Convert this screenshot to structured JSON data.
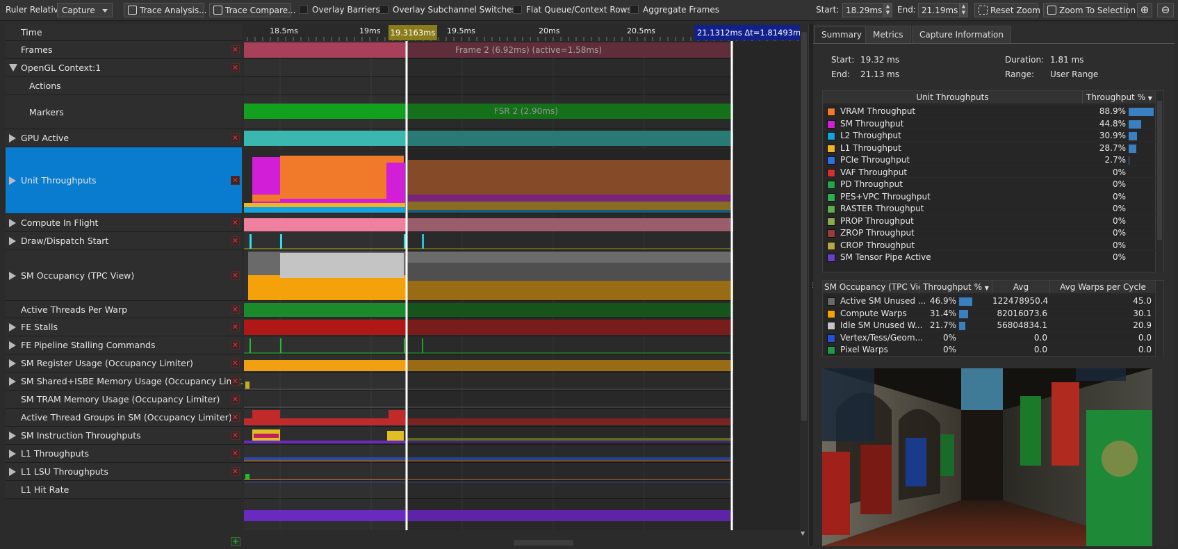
{
  "toolbar": {
    "ruler_label": "Ruler Relative:",
    "ruler_value": "Capture",
    "trace_analysis": "Trace Analysis...",
    "trace_compare": "Trace Compare...",
    "overlay_barriers": "Overlay Barriers",
    "overlay_subchannel": "Overlay Subchannel Switches",
    "flat_queue": "Flat Queue/Context Rows",
    "aggregate_frames": "Aggregate Frames",
    "start_label": "Start:",
    "start_value": "18.29ms",
    "end_label": "End:",
    "end_value": "21.19ms",
    "reset_zoom": "Reset Zoom",
    "zoom_to_selection": "Zoom To Selection"
  },
  "rows": [
    {
      "label": "Time",
      "expander": "none",
      "remove": false
    },
    {
      "label": "Frames",
      "expander": "none",
      "remove": true
    },
    {
      "label": "OpenGL Context:1",
      "expander": "expanded",
      "remove": true
    },
    {
      "label": "Actions",
      "expander": "none",
      "remove": false,
      "indent": true
    },
    {
      "label": "Markers",
      "expander": "none",
      "remove": false,
      "indent": true
    },
    {
      "label": "GPU Active",
      "expander": "collapsed",
      "remove": true
    },
    {
      "label": "Unit Throughputs",
      "expander": "collapsed",
      "remove": true,
      "selected": true
    },
    {
      "label": "Compute In Flight",
      "expander": "collapsed",
      "remove": true
    },
    {
      "label": "Draw/Dispatch Start",
      "expander": "collapsed",
      "remove": true
    },
    {
      "label": "SM Occupancy (TPC View)",
      "expander": "collapsed",
      "remove": true
    },
    {
      "label": "Active Threads Per Warp",
      "expander": "none",
      "remove": true
    },
    {
      "label": "FE Stalls",
      "expander": "collapsed",
      "remove": true
    },
    {
      "label": "FE Pipeline Stalling Commands",
      "expander": "collapsed",
      "remove": true
    },
    {
      "label": "SM Register Usage (Occupancy Limiter)",
      "expander": "collapsed",
      "remove": true
    },
    {
      "label": "SM Shared+ISBE Memory Usage (Occupancy Limit...",
      "expander": "collapsed",
      "remove": true
    },
    {
      "label": "SM TRAM Memory Usage (Occupancy Limiter)",
      "expander": "none",
      "remove": true
    },
    {
      "label": "Active Thread Groups in SM (Occupancy Limiter)",
      "expander": "none",
      "remove": true
    },
    {
      "label": "SM Instruction Throughputs",
      "expander": "collapsed",
      "remove": true
    },
    {
      "label": "L1 Throughputs",
      "expander": "collapsed",
      "remove": true
    },
    {
      "label": "L1 LSU Throughputs",
      "expander": "collapsed",
      "remove": true
    },
    {
      "label": "L1 Hit Rate",
      "expander": "none",
      "remove": false
    }
  ],
  "timeline": {
    "ticks": [
      "18.5ms",
      "19ms",
      "19.5ms",
      "20ms",
      "20.5ms"
    ],
    "cursor_label": "19.3163ms",
    "range_label": "21.1312ms Δt=1.81493ms",
    "frame_label": "Frame 2 (6.92ms) (active=1.58ms)",
    "marker_label": "FSR 2 (2.90ms)"
  },
  "tabs": [
    "Summary",
    "Metrics",
    "Capture Information"
  ],
  "summary": {
    "start_label": "Start:",
    "start_value": "19.32 ms",
    "end_label": "End:",
    "end_value": "21.13 ms",
    "duration_label": "Duration:",
    "duration_value": "1.81 ms",
    "range_label": "Range:",
    "range_value": "User Range"
  },
  "unit_table": {
    "headers": [
      "Unit Throughputs",
      "Throughput %"
    ],
    "rows": [
      {
        "name": "VRAM Throughput",
        "value": "88.9%",
        "pct": 88.9,
        "color": "#f07a2a"
      },
      {
        "name": "SM Throughput",
        "value": "44.8%",
        "pct": 44.8,
        "color": "#d21ed6"
      },
      {
        "name": "L2 Throughput",
        "value": "30.9%",
        "pct": 30.9,
        "color": "#12a4e0"
      },
      {
        "name": "L1 Throughput",
        "value": "28.7%",
        "pct": 28.7,
        "color": "#f0b51e"
      },
      {
        "name": "PCIe Throughput",
        "value": "2.7%",
        "pct": 2.7,
        "color": "#2f6fe6"
      },
      {
        "name": "VAF Throughput",
        "value": "0%",
        "pct": 0,
        "color": "#d33030"
      },
      {
        "name": "PD Throughput",
        "value": "0%",
        "pct": 0,
        "color": "#22a64a"
      },
      {
        "name": "PES+VPC Throughput",
        "value": "0%",
        "pct": 0,
        "color": "#2fae4c"
      },
      {
        "name": "RASTER Throughput",
        "value": "0%",
        "pct": 0,
        "color": "#5fae4a"
      },
      {
        "name": "PROP Throughput",
        "value": "0%",
        "pct": 0,
        "color": "#8ea84a"
      },
      {
        "name": "ZROP Throughput",
        "value": "0%",
        "pct": 0,
        "color": "#9a3a3a"
      },
      {
        "name": "CROP Throughput",
        "value": "0%",
        "pct": 0,
        "color": "#b6a848"
      },
      {
        "name": "SM Tensor Pipe Active",
        "value": "0%",
        "pct": 0,
        "color": "#6a3fc8"
      }
    ]
  },
  "occ_table": {
    "headers": [
      "SM Occupancy (TPC View",
      "Throughput %",
      "Avg",
      "Avg Warps per Cycle"
    ],
    "rows": [
      {
        "name": "Active SM Unused ...",
        "value": "46.9%",
        "pct": 46.9,
        "avg": "122478950.4",
        "warps": "45.0",
        "color": "#6a6a6a"
      },
      {
        "name": "Compute Warps",
        "value": "31.4%",
        "pct": 31.4,
        "avg": "82016073.6",
        "warps": "30.1",
        "color": "#f5a20a"
      },
      {
        "name": "Idle SM Unused W...",
        "value": "21.7%",
        "pct": 21.7,
        "avg": "56804834.1",
        "warps": "20.9",
        "color": "#c4c4c4"
      },
      {
        "name": "Vertex/Tess/Geom...",
        "value": "0%",
        "pct": 0,
        "avg": "0.0",
        "warps": "0.0",
        "color": "#2451d6"
      },
      {
        "name": "Pixel Warps",
        "value": "0%",
        "pct": 0,
        "avg": "0.0",
        "warps": "0.0",
        "color": "#1f9a4a"
      }
    ]
  }
}
